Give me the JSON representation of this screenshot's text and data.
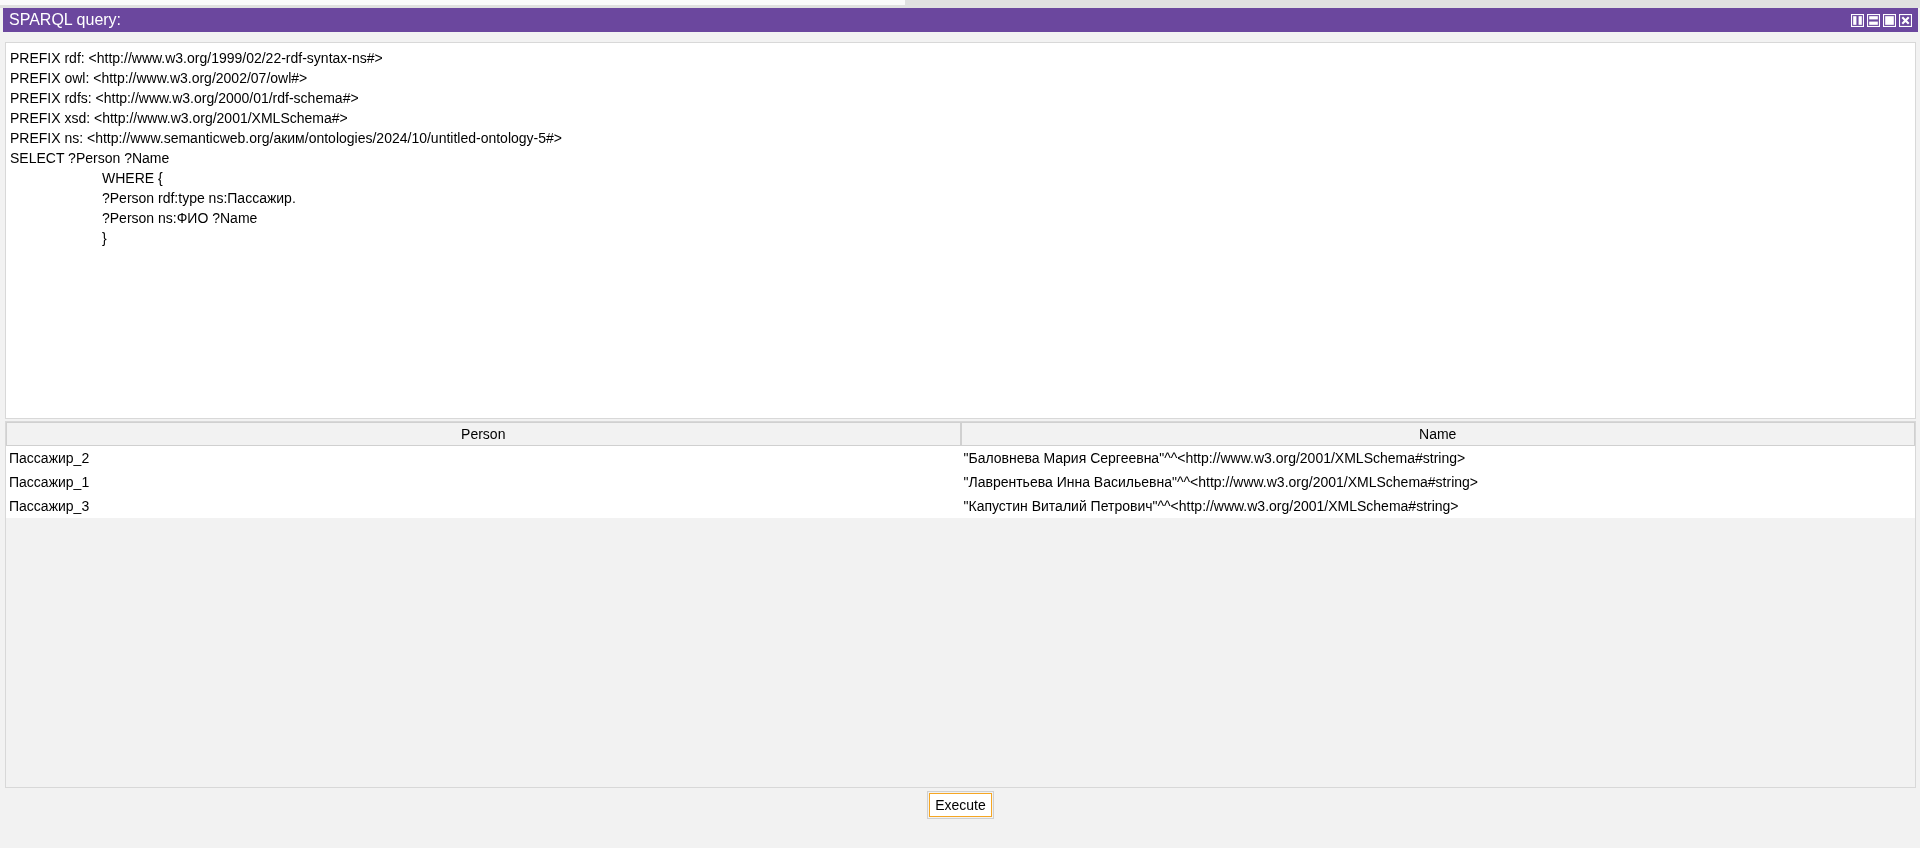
{
  "panel": {
    "title": "SPARQL query:"
  },
  "query": "PREFIX rdf: <http://www.w3.org/1999/02/22-rdf-syntax-ns#>\nPREFIX owl: <http://www.w3.org/2002/07/owl#>\nPREFIX rdfs: <http://www.w3.org/2000/01/rdf-schema#>\nPREFIX xsd: <http://www.w3.org/2001/XMLSchema#>\nPREFIX ns: <http://www.semanticweb.org/аким/ontologies/2024/10/untitled-ontology-5#>\nSELECT ?Person ?Name\n\t\tWHERE {\n\t\t?Person rdf:type ns:Пассажир.\n\t\t?Person ns:ФИО ?Name\n\t\t}",
  "table": {
    "columns": [
      "Person",
      "Name"
    ],
    "rows": [
      [
        "Пассажир_2",
        "\"Баловнева Мария Сергеевна\"^^<http://www.w3.org/2001/XMLSchema#string>"
      ],
      [
        "Пассажир_1",
        "\"Лаврентьева Инна Васильевна\"^^<http://www.w3.org/2001/XMLSchema#string>"
      ],
      [
        "Пассажир_3",
        "\"Капустин Виталий Петрович\"^^<http://www.w3.org/2001/XMLSchema#string>"
      ]
    ]
  },
  "buttons": [
    "Execute"
  ]
}
